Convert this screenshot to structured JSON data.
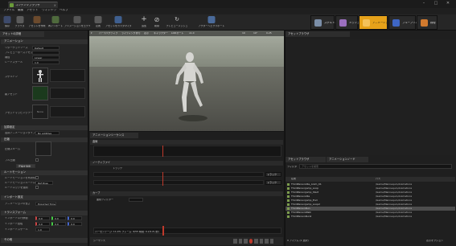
{
  "colors": {
    "accent": "#e6a21a",
    "background": "#151515",
    "panel": "#242424",
    "playhead": "#c0392b",
    "selected_row": "#4d4d4d"
  },
  "title": {
    "tab": "コンテンツブラウザ",
    "close": "×",
    "minimize": "–",
    "maximize": "□",
    "close_window": "✕"
  },
  "menu": [
    "ファイル",
    "編集",
    "アセット",
    "ウィンドウ",
    "ヘルプ"
  ],
  "toolbar": {
    "buttons": [
      {
        "label": "保存",
        "icon": "save-icon"
      },
      {
        "label": "ブラウズ",
        "icon": "browse-icon"
      },
      {
        "label": "アセットを作成",
        "icon": "create-asset-icon"
      },
      {
        "label": "再インポート",
        "icon": "reimport-icon"
      },
      {
        "label": "アニメーションをエクスポート",
        "icon": "export-animation-icon"
      },
      {
        "label": "定義",
        "icon": "define-icon"
      },
      {
        "label": "アセットをカスタマイズ",
        "icon": "customize-icon"
      },
      {
        "label": "追加",
        "icon": "add-icon"
      },
      {
        "label": "削除",
        "icon": "remove-icon"
      },
      {
        "label": "プレビューメッシュ",
        "icon": "preview-mesh-icon"
      },
      {
        "label": "アクターへエクスポート",
        "icon": "export-actor-icon"
      }
    ],
    "modes": [
      {
        "label": "スケルトン",
        "active": false
      },
      {
        "label": "メッシュ",
        "active": false
      },
      {
        "label": "アニメーション",
        "active": true
      },
      {
        "label": "ブループリント",
        "active": false
      },
      {
        "label": "物理",
        "active": false
      }
    ]
  },
  "details": {
    "tab": "アセットの詳細",
    "sections": {
      "animation": "アニメーション",
      "additive": "加算設定",
      "compression": "圧縮",
      "root_motion": "ルートモーション",
      "import": "インポート設定",
      "transform": "トランスフォーム",
      "misc": "その他"
    },
    "rows": [
      {
        "label": "リターゲットソース",
        "value": "Default"
      },
      {
        "label": "プレビューポーズアセット",
        "value": ""
      },
      {
        "label": "補間",
        "value": "Linear"
      },
      {
        "label": "レートスケール",
        "value": "1.0"
      }
    ],
    "thumb_labels": [
      "スケルトン",
      "親アセット",
      "アセットマッピングテーブル"
    ],
    "none": "None",
    "additive_type": {
      "label": "加算アニメーションタイプ",
      "value": "No additive"
    },
    "compression_label": "圧縮スキーム",
    "compression_note": "フル圧縮",
    "compress_button": "圧縮を適用",
    "root_rows": [
      {
        "label": "ルートモーションを有効化",
        "value": ""
      },
      {
        "label": "ルートモーションルートロック",
        "value": "Ref Pose"
      },
      {
        "label": "ルートロックを強制",
        "value": ""
      }
    ],
    "import_row": {
      "label": "アニメーションの長さ",
      "value": "Exported Time"
    },
    "transform_rows": [
      {
        "label": "インポート平行移動",
        "values": [
          "0.0",
          "0.0",
          "0.0"
        ]
      },
      {
        "label": "インポート回転",
        "values": [
          "0.0",
          "0.0",
          "0.0"
        ]
      },
      {
        "label": "インポートスケール",
        "values": [
          "1.0"
        ]
      }
    ]
  },
  "viewport": {
    "buttons": [
      "▾",
      "パースペクティブ",
      "ライティングあり",
      "表示",
      "キャラクター",
      "LODオート",
      "x1.0"
    ],
    "right_buttons": [
      "10",
      "10°",
      "0.25"
    ]
  },
  "timeline": {
    "tab": "アニメーションシーケンス",
    "sect1": "曲線",
    "sect2": "ノーティファイ",
    "sect2_label": "トラック",
    "track_buttons": [
      "トラック",
      "トラック"
    ],
    "sect3": "カーブ",
    "curve_label": "曲線フィルター",
    "status": "パーセンテージ: 11.0%  フレーム: 6/55  時間: 0.2/1.8 (秒)",
    "play_label": "シーケンス"
  },
  "browser": {
    "tab": "アセットブラウザ",
    "tab2": "アニメーションノード",
    "filter_label": "フィルタ",
    "search_placeholder": "アセットを検索",
    "columns": [
      "名前",
      "パス"
    ],
    "assets": [
      {
        "name": "ThirdPersonIdle_Anim_01",
        "path": "/Game/Mannequin/Animations",
        "selected": false
      },
      {
        "name": "ThirdPersonJump_Loop",
        "path": "/Game/Mannequin/Animations",
        "selected": false
      },
      {
        "name": "ThirdPersonJump_Start",
        "path": "/Game/Mannequin/Animations",
        "selected": false
      },
      {
        "name": "ThirdPersonIdle",
        "path": "/Game/Mannequin/Animations",
        "selected": false
      },
      {
        "name": "ThirdPersonJump_End",
        "path": "/Game/Mannequin/Animations",
        "selected": false
      },
      {
        "name": "ThirdPersonJump_Loop2",
        "path": "/Game/Mannequin/Animations",
        "selected": false
      },
      {
        "name": "ThirdPersonRun",
        "path": "/Game/Mannequin/Animations",
        "selected": true
      },
      {
        "name": "ThirdPersonWalk",
        "path": "/Game/Mannequin/Animations",
        "selected": false
      },
      {
        "name": "ThirdPersonRun2",
        "path": "/Game/Mannequin/Animations",
        "selected": false
      }
    ],
    "count": "9 アイテム (1 選択)",
    "view_options": "表示オプション"
  }
}
